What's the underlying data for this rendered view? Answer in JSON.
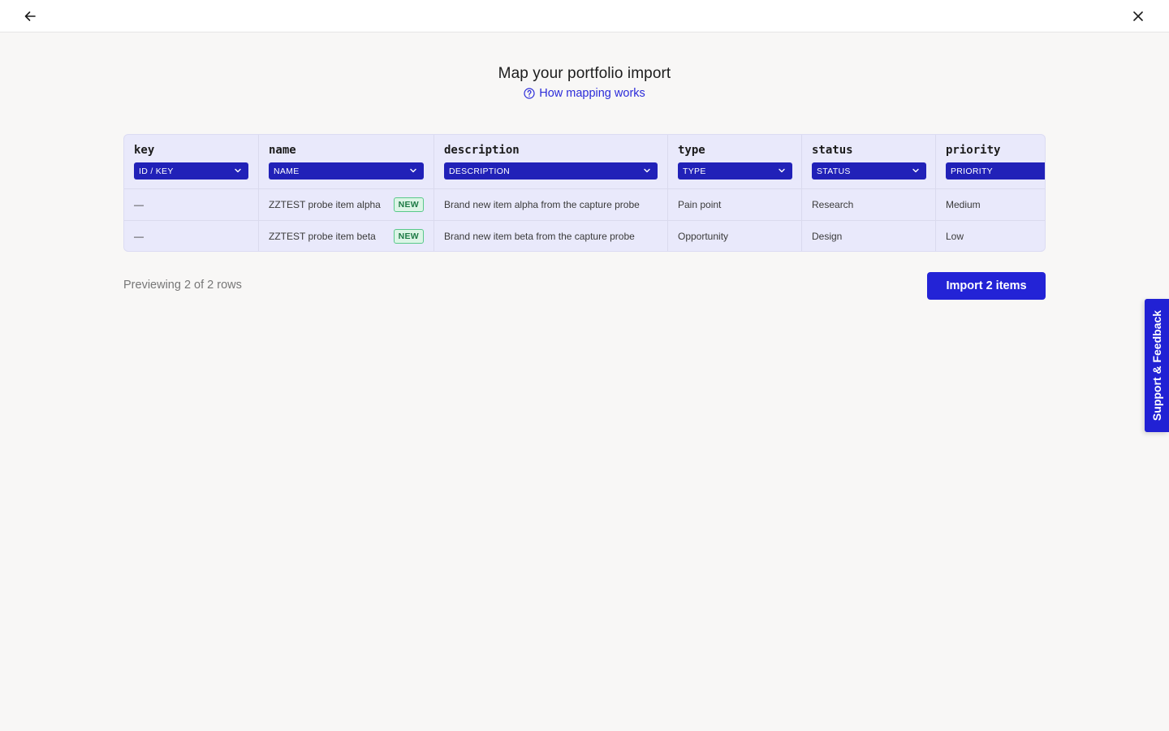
{
  "topbar": {
    "back_icon": "arrow-left-icon",
    "close_icon": "close-icon"
  },
  "page": {
    "title": "Map your portfolio import",
    "help_link": "How mapping works",
    "help_icon": "question-circle-icon"
  },
  "table": {
    "columns": [
      {
        "title": "key",
        "mapping": "ID / KEY"
      },
      {
        "title": "name",
        "mapping": "NAME"
      },
      {
        "title": "description",
        "mapping": "DESCRIPTION"
      },
      {
        "title": "type",
        "mapping": "TYPE"
      },
      {
        "title": "status",
        "mapping": "STATUS"
      },
      {
        "title": "priority",
        "mapping": "PRIORITY"
      }
    ],
    "rows": [
      {
        "key": "—",
        "name": "ZZTEST probe item alpha",
        "badge": "NEW",
        "description": "Brand new item alpha from the capture probe",
        "type": "Pain point",
        "status": "Research",
        "priority": "Medium"
      },
      {
        "key": "—",
        "name": "ZZTEST probe item beta",
        "badge": "NEW",
        "description": "Brand new item beta from the capture probe",
        "type": "Opportunity",
        "status": "Design",
        "priority": "Low"
      }
    ]
  },
  "footer": {
    "preview_text": "Previewing 2 of 2 rows",
    "import_button": "Import 2 items"
  },
  "support_tab": {
    "label": "Support & Feedback"
  },
  "colors": {
    "accent": "#2323d6",
    "select_bg": "#2121b8",
    "table_bg": "#e9e9fb",
    "badge_bg": "#dcf5e6",
    "badge_text": "#1d7a45",
    "page_bg": "#f8f7f6"
  }
}
